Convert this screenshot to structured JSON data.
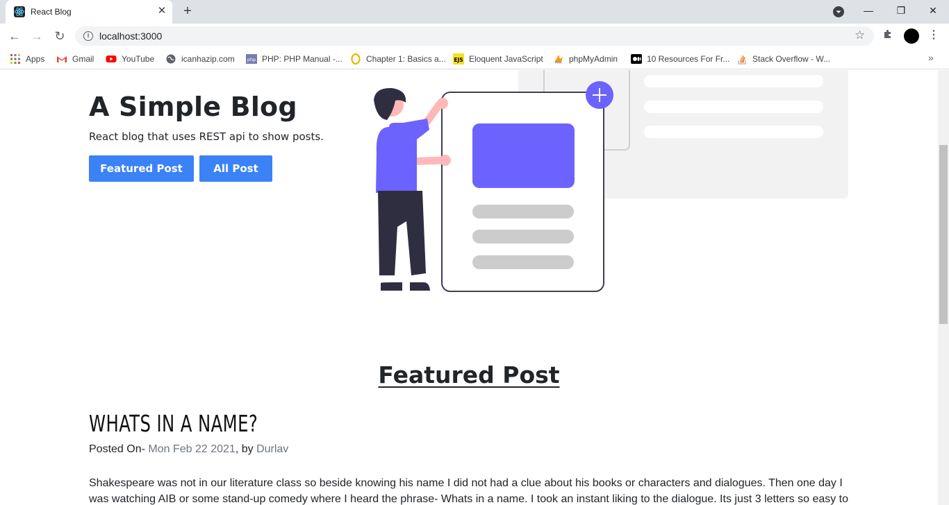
{
  "browser": {
    "tab": {
      "title": "React Blog"
    },
    "url": "localhost:3000",
    "bookmarks": [
      {
        "label": "Apps",
        "icon": "apps-grid-icon",
        "color": "#e8453c"
      },
      {
        "label": "Gmail",
        "icon": "gmail-icon",
        "color": "#ea4335"
      },
      {
        "label": "YouTube",
        "icon": "youtube-icon",
        "color": "#ff0000"
      },
      {
        "label": "icanhazip.com",
        "icon": "globe-icon",
        "color": "#5f6368"
      },
      {
        "label": "PHP: PHP Manual -...",
        "icon": "php-icon",
        "color": "#777bb3"
      },
      {
        "label": "Chapter 1: Basics a...",
        "icon": "opera-icon",
        "color": "#f0b400"
      },
      {
        "label": "Eloquent JavaScript",
        "icon": "ejs-icon",
        "color": "#f7df1e"
      },
      {
        "label": "phpMyAdmin",
        "icon": "phpmyadmin-icon",
        "color": "#f89c0e"
      },
      {
        "label": "10 Resources For Fr...",
        "icon": "medium-icon",
        "color": "#000000"
      },
      {
        "label": "Stack Overflow - W...",
        "icon": "stackoverflow-icon",
        "color": "#f48024"
      }
    ]
  },
  "hero": {
    "title": "A Simple Blog",
    "subtitle": "React blog that uses REST api to show posts.",
    "featured_button": "Featured Post",
    "all_button": "All Post"
  },
  "featured": {
    "heading": "Featured Post",
    "post": {
      "title": "WHATS IN A NAME?",
      "posted_label": "Posted On-",
      "date": "Mon Feb 22 2021",
      "by_label": ", by",
      "author": "Durlav",
      "body": "Shakespeare was not in our literature class so beside knowing his name I did not had a clue about his books or characters and dialogues. Then one day I was watching AIB or some stand-up comedy where I heard the phrase- Whats in a name. I took an instant liking to the dialogue. Its just 3 letters so easy to"
    }
  },
  "colors": {
    "accent": "#3b82f6",
    "illustration_purple": "#6c63ff"
  }
}
